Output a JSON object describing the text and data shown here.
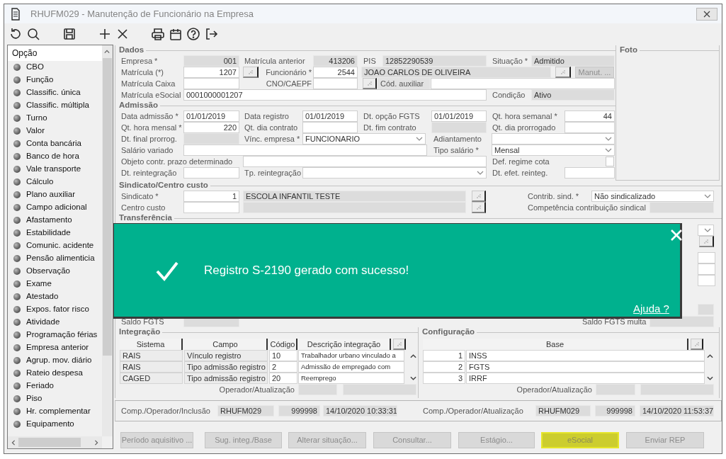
{
  "window": {
    "title": "RHUFM029 - Manutenção de Funcionário na Empresa"
  },
  "sidebar": {
    "header": "Opção",
    "items": [
      "CBO",
      "Função",
      "Classific. única",
      "Classific. múltipla",
      "Turno",
      "Valor",
      "Conta bancária",
      "Banco de hora",
      "Vale transporte",
      "Cálculo",
      "Plano auxiliar",
      "Campo adicional",
      "Afastamento",
      "Estabilidade",
      "Comunic. acidente",
      "Pensão alimenticia",
      "Observação",
      "Exame",
      "Atestado",
      "Expos. fator risco",
      "Atividade",
      "Programação férias",
      "Empresa anterior",
      "Agrup. mov. diário",
      "Rateio despesa",
      "Feriado",
      "Piso",
      "Hr. complementar",
      "Equipamento"
    ]
  },
  "form_sections": [
    {
      "legend": "Dados",
      "rows": [
        {
          "items": [
            {
              "kind": "label",
              "text": "Empresa *"
            },
            {
              "kind": "input",
              "value": "001",
              "disabled": true
            },
            {
              "kind": "label",
              "text": "Matrícula anterior"
            },
            {
              "kind": "input",
              "value": "413206",
              "disabled": true
            },
            {
              "kind": "label",
              "text": "PIS"
            },
            {
              "kind": "input",
              "value": "12852290539",
              "disabled": true
            },
            {
              "kind": "label",
              "text": "Situação *"
            },
            {
              "kind": "input",
              "value": "Admitido",
              "disabled": true
            }
          ]
        },
        {
          "items": [
            {
              "kind": "label",
              "text": "Matrícula (*)"
            },
            {
              "kind": "input",
              "value": "1207",
              "disabled": false
            },
            {
              "kind": "lookup"
            },
            {
              "kind": "label",
              "text": "Funcionário *"
            },
            {
              "kind": "input",
              "value": "2544",
              "disabled": false
            },
            {
              "kind": "input",
              "value": "JOAO CARLOS DE OLIVEIRA",
              "disabled": true
            },
            {
              "kind": "lookup"
            },
            {
              "kind": "button",
              "text": "Manut. ...",
              "disabled": true
            }
          ]
        },
        {
          "items": [
            {
              "kind": "label",
              "text": "Matrícula Caixa"
            },
            {
              "kind": "input",
              "disabled": false
            },
            {
              "kind": "label",
              "text": "CNO/CAEPF"
            },
            {
              "kind": "input",
              "disabled": false
            },
            {
              "kind": "lookup"
            },
            {
              "kind": "label",
              "text": "Cód. auxiliar"
            },
            {
              "kind": "input",
              "disabled": false
            }
          ]
        },
        {
          "items": [
            {
              "kind": "label",
              "text": "Matrícula eSocial"
            },
            {
              "kind": "input",
              "value": "0001000001207",
              "disabled": false
            },
            {
              "kind": "label",
              "text": "Condição"
            },
            {
              "kind": "input",
              "value": "Ativo",
              "disabled": true
            }
          ]
        }
      ]
    },
    {
      "legend": "Admissão",
      "rows": [
        {
          "items": [
            {
              "kind": "label",
              "text": "Data admissão *"
            },
            {
              "kind": "input",
              "value": "01/01/2019",
              "disabled": false
            },
            {
              "kind": "label",
              "text": "Data registro"
            },
            {
              "kind": "input",
              "value": "01/01/2019",
              "disabled": false
            },
            {
              "kind": "label",
              "text": "Dt. opção FGTS"
            },
            {
              "kind": "input",
              "value": "01/01/2019",
              "disabled": false
            },
            {
              "kind": "label",
              "text": "Qt. hora semanal *"
            },
            {
              "kind": "input",
              "value": "44",
              "disabled": false
            }
          ]
        },
        {
          "items": [
            {
              "kind": "label",
              "text": "Qt. hora mensal *"
            },
            {
              "kind": "input",
              "value": "220",
              "disabled": false
            },
            {
              "kind": "label",
              "text": "Qt. dia contrato"
            },
            {
              "kind": "input",
              "disabled": false
            },
            {
              "kind": "label",
              "text": "Dt. fim contrato"
            },
            {
              "kind": "input",
              "disabled": true
            },
            {
              "kind": "label",
              "text": "Qt. dia prorrogado"
            },
            {
              "kind": "input",
              "disabled": false
            }
          ]
        },
        {
          "items": [
            {
              "kind": "label",
              "text": "Dt. final prorrog."
            },
            {
              "kind": "input",
              "disabled": true
            },
            {
              "kind": "label",
              "text": "Vínc. empresa *"
            },
            {
              "kind": "select",
              "value": "FUNCIONARIO"
            },
            {
              "kind": "label",
              "text": "Adiantamento"
            },
            {
              "kind": "select"
            }
          ]
        },
        {
          "items": [
            {
              "kind": "label",
              "text": "Salário variado"
            },
            {
              "kind": "input",
              "disabled": false
            },
            {
              "kind": "label",
              "text": "Tipo salário *"
            },
            {
              "kind": "select",
              "value": "Mensal"
            }
          ]
        },
        {
          "items": [
            {
              "kind": "label",
              "text": "Objeto contr. prazo determinado"
            },
            {
              "kind": "input",
              "disabled": false
            },
            {
              "kind": "label",
              "text": "Def. regime cota"
            },
            {
              "kind": "checkbox",
              "checked": false
            }
          ]
        },
        {
          "items": [
            {
              "kind": "label",
              "text": "Dt. reintegração"
            },
            {
              "kind": "input",
              "disabled": false
            },
            {
              "kind": "label",
              "text": "Tp. reintegração"
            },
            {
              "kind": "select"
            },
            {
              "kind": "label",
              "text": "Dt. efet. reinteg."
            },
            {
              "kind": "input",
              "disabled": false
            }
          ]
        }
      ]
    },
    {
      "legend": "Sindicato/Centro custo",
      "rows": [
        {
          "items": [
            {
              "kind": "label",
              "text": "Sindicato *"
            },
            {
              "kind": "input",
              "value": "1",
              "disabled": false
            },
            {
              "kind": "input",
              "value": "ESCOLA INFANTIL TESTE",
              "disabled": true
            },
            {
              "kind": "lookup"
            },
            {
              "kind": "label",
              "text": "Contrib. sind. *"
            },
            {
              "kind": "select",
              "value": "Não sindicalizado"
            }
          ]
        },
        {
          "items": [
            {
              "kind": "label",
              "text": "Centro custo"
            },
            {
              "kind": "input",
              "disabled": false
            },
            {
              "kind": "input",
              "disabled": true
            },
            {
              "kind": "lookup"
            },
            {
              "kind": "label",
              "text": "Competência contribuição sindical"
            },
            {
              "kind": "input",
              "disabled": true
            }
          ]
        }
      ]
    }
  ],
  "photo_panel": {
    "legend": "Foto"
  },
  "transfer_section": {
    "legend": "Transferência",
    "fields": [
      {
        "kind": "select"
      },
      {
        "kind": "lookup"
      },
      {
        "kind": "input",
        "disabled": false
      },
      {
        "kind": "input",
        "disabled": false
      },
      {
        "kind": "input",
        "disabled": false
      },
      {
        "kind": "input",
        "disabled": true
      }
    ]
  },
  "balance_row": [
    {
      "kind": "label",
      "text": "Saldo FGTS"
    },
    {
      "kind": "input",
      "disabled": true
    },
    {
      "kind": "label",
      "text": "Saldo FGTS multa"
    },
    {
      "kind": "input",
      "disabled": true
    }
  ],
  "integration": {
    "legend": "Integração",
    "columns": [
      "Sistema",
      "Campo",
      "Código",
      "Descrição integração"
    ],
    "rows": [
      [
        "RAIS",
        "Vínculo registro",
        "10",
        "Trabalhador urbano vinculado a"
      ],
      [
        "RAIS",
        "Tipo admissão registro",
        "2",
        "Admissão de empregado com"
      ],
      [
        "CAGED",
        "Tipo admissão registro",
        "20",
        "Reemprego"
      ]
    ],
    "footer_label": "Operador/Atualização"
  },
  "configuration": {
    "legend": "Configuração",
    "columns": [
      "Base"
    ],
    "rows": [
      [
        "1",
        "INSS"
      ],
      [
        "2",
        "FGTS"
      ],
      [
        "3",
        "IRRF"
      ]
    ],
    "footer_label": "Operador/Atualização"
  },
  "audit": [
    {
      "label": "Comp./Operador/Inclusão",
      "values": [
        "RHUFM029",
        "999998",
        "14/10/2020 10:33:31"
      ]
    },
    {
      "label": "Comp./Operador/Atualização",
      "values": [
        "RHUFM029",
        "999998",
        "14/10/2020 11:53:37"
      ]
    }
  ],
  "buttons": [
    {
      "text": "Período aquisitivo ...",
      "highlighted": false
    },
    {
      "text": "Sug. integ./Base",
      "highlighted": false
    },
    {
      "text": "Alterar situação...",
      "highlighted": false
    },
    {
      "text": "Consultar...",
      "highlighted": false
    },
    {
      "text": "Estágio...",
      "highlighted": false
    },
    {
      "text": "eSocial",
      "highlighted": true
    },
    {
      "text": "Enviar REP",
      "highlighted": false
    }
  ],
  "toast": {
    "message": "Registro S-2190 gerado com sucesso!",
    "link": "Ajuda ?"
  }
}
